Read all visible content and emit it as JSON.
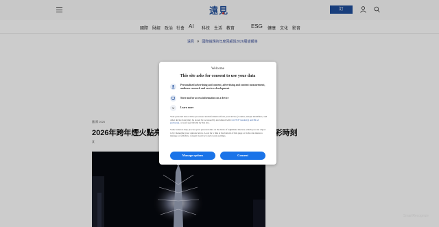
{
  "header": {
    "logo_text": "遠見",
    "subscribe_label": "訂",
    "menu_icon": "hamburger-menu-icon",
    "user_icon": "user-icon",
    "search_icon": "search-icon"
  },
  "nav": {
    "items": [
      "國際",
      "財經",
      "政治",
      "社會",
      "AI",
      "科技",
      "生活",
      "教育",
      "ESG",
      "健康",
      "文化",
      "影音"
    ]
  },
  "breadcrumb": {
    "home": "遠見",
    "path": "國際議題的年度回顧與2026展望報導"
  },
  "article": {
    "meta": "國 際 2026",
    "title": "2026年跨年煙火點亮夜空，全球各地迎接新年到來的精彩時刻",
    "author": "文"
  },
  "consent": {
    "welcome": "Welcome",
    "title": "This site asks for consent to use your data",
    "purposes": [
      {
        "icon": "person-icon",
        "text": "Personalised advertising and content, advertising and content measurement, audience research and services development"
      },
      {
        "icon": "device-icon",
        "text": "Store and/or access information on a device"
      },
      {
        "icon": "chevron-down-icon",
        "text": "Learn more"
      }
    ],
    "body_1_pre": "Your personal data will be processed and information from your device (cookies, unique identifiers, and other device data) may be stored by, accessed by and shared with ",
    "vendors_link": "141 TCF vendor(s) and 69 ad partner(s)",
    "body_1_post": ", or used specifically by this site.",
    "body_2": "Some vendors may process your personal data on the basis of legitimate interest, which you can object to by managing your options below. Look for a link at the bottom of this page or in the site menu to manage or withdraw consent in privacy and cookie settings.",
    "manage_label": "Manage options",
    "consent_label": "Consent"
  },
  "watermark": "SmartRecognize"
}
